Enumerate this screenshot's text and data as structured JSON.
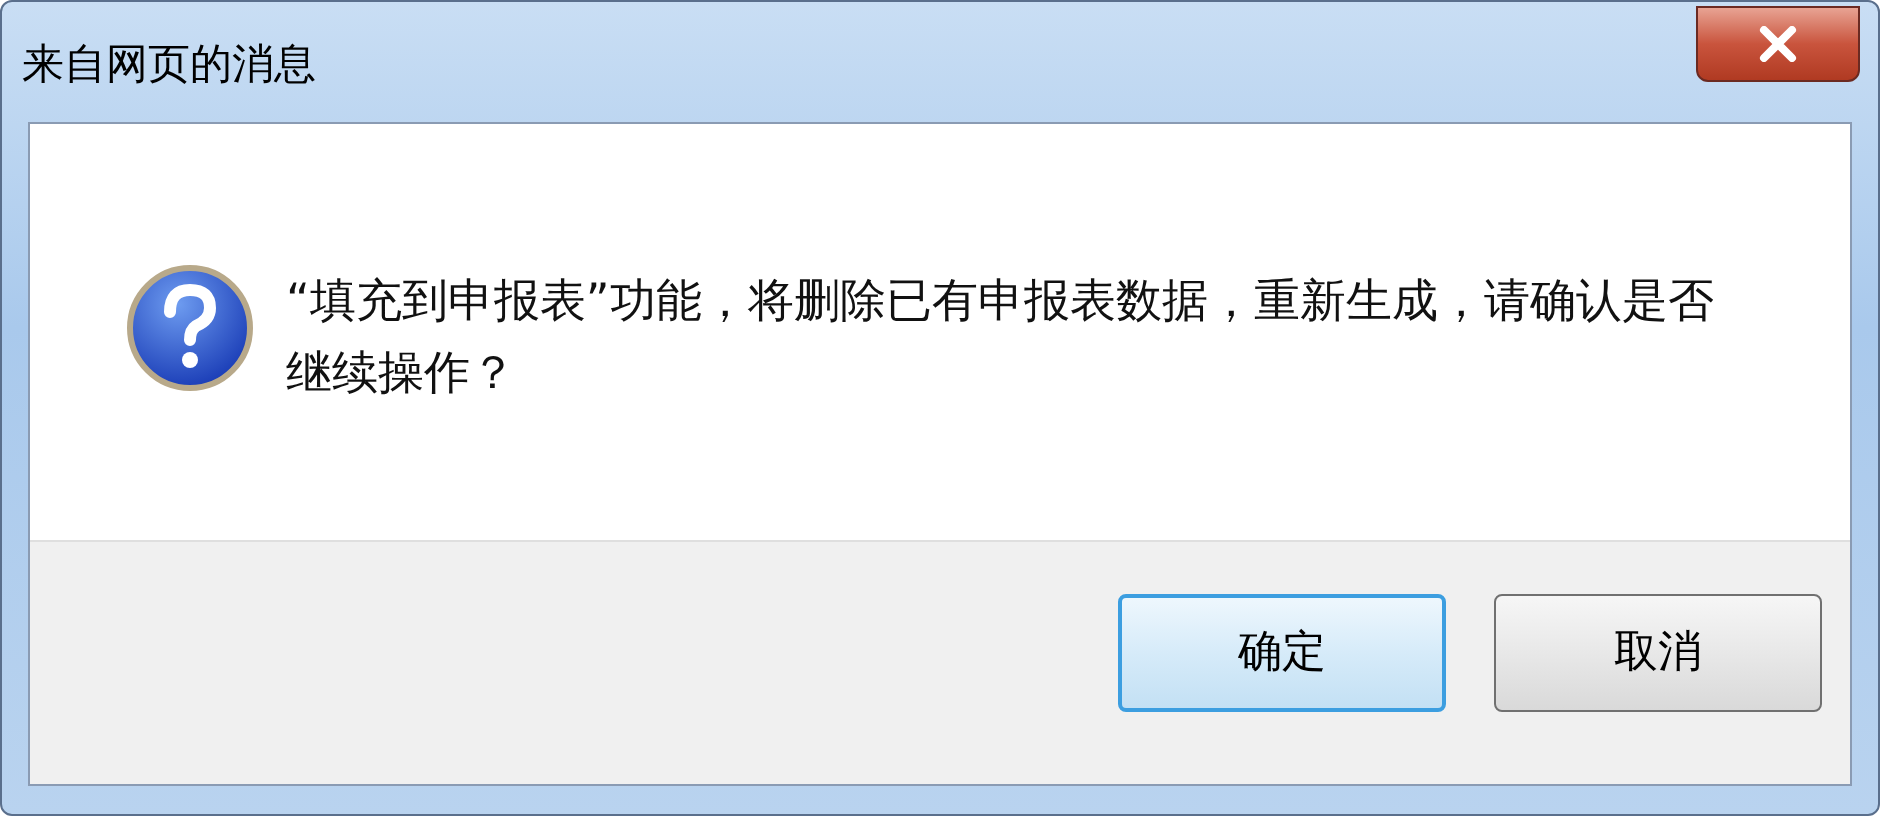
{
  "window": {
    "title": "来自网页的消息"
  },
  "message": "“填充到申报表”功能，将删除已有申报表数据，重新生成，请确认是否继续操作？",
  "buttons": [
    {
      "label": "确定",
      "default": true
    },
    {
      "label": "取消",
      "default": false
    }
  ]
}
